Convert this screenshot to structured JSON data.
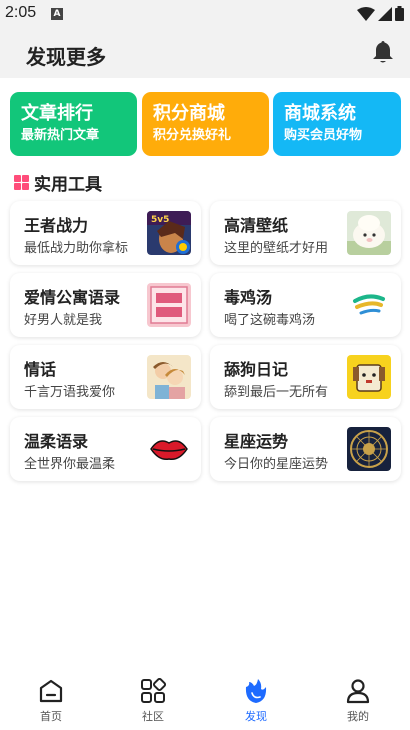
{
  "status_bar": {
    "time": "2:05",
    "notification_badge": "A"
  },
  "header": {
    "title": "发现更多"
  },
  "promos": [
    {
      "title": "文章排行",
      "subtitle": "最新热门文章",
      "color": "#12c67a"
    },
    {
      "title": "积分商城",
      "subtitle": "积分兑换好礼",
      "color": "#ffac0a"
    },
    {
      "title": "商城系统",
      "subtitle": "购买会员好物",
      "color": "#14b8f5"
    }
  ],
  "section": {
    "title": "实用工具"
  },
  "tools": [
    {
      "title": "王者战力",
      "subtitle": "最低战力助你拿标",
      "icon": "game-hero-thumbnail-icon"
    },
    {
      "title": "高清壁纸",
      "subtitle": "这里的壁纸才好用",
      "icon": "sheep-wallpaper-thumbnail-icon"
    },
    {
      "title": "爱情公寓语录",
      "subtitle": "好男人就是我",
      "icon": "tv-show-poster-thumbnail-icon"
    },
    {
      "title": "毒鸡汤",
      "subtitle": "喝了这碗毒鸡汤",
      "icon": "soup-logo-thumbnail-icon"
    },
    {
      "title": "情话",
      "subtitle": "千言万语我爱你",
      "icon": "couple-illustration-thumbnail-icon"
    },
    {
      "title": "舔狗日记",
      "subtitle": "舔到最后一无所有",
      "icon": "dog-cartoon-thumbnail-icon"
    },
    {
      "title": "温柔语录",
      "subtitle": "全世界你最温柔",
      "icon": "red-lips-icon"
    },
    {
      "title": "星座运势",
      "subtitle": "今日你的星座运势",
      "icon": "zodiac-wheel-thumbnail-icon"
    }
  ],
  "tabbar": [
    {
      "label": "首页",
      "icon": "home-icon",
      "active": false
    },
    {
      "label": "社区",
      "icon": "grid-apps-icon",
      "active": false
    },
    {
      "label": "发现",
      "icon": "discover-icon",
      "active": true
    },
    {
      "label": "我的",
      "icon": "profile-icon",
      "active": false
    }
  ],
  "colors": {
    "accent": "#1e6bff",
    "section_icon": "#ff4d7a"
  }
}
